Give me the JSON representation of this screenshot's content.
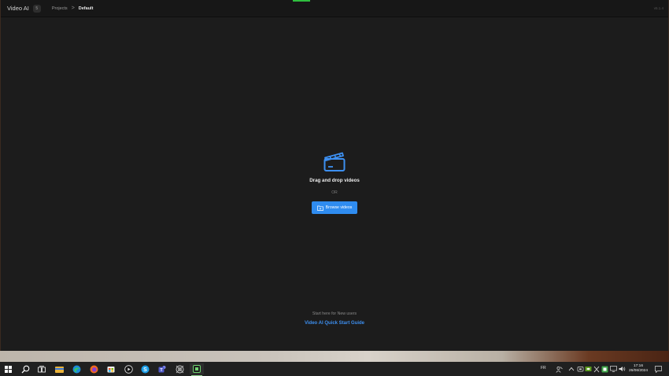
{
  "window": {
    "app_name": "Video AI",
    "app_badge": "5",
    "version": "v5.1.4"
  },
  "breadcrumb": {
    "projects": "Projects",
    "separator": ">",
    "current": "Default"
  },
  "dropzone": {
    "icon": "clapperboard-icon",
    "title": "Drag and drop videos",
    "or": "OR",
    "browse_label": "Browse videos"
  },
  "guide": {
    "hint": "Start here for New users",
    "link": "Video AI Quick Start Guide"
  },
  "taskbar": {
    "apps": [
      "windows-start-icon",
      "search-icon",
      "task-view-icon",
      "file-explorer-icon",
      "edge-icon",
      "firefox-icon",
      "store-icon",
      "video-player-icon",
      "skype-icon",
      "teams-icon",
      "settings-app-icon",
      "video-ai-icon"
    ],
    "language": "FR",
    "time": "17:16",
    "date": "26/06/2024"
  },
  "colors": {
    "accent": "#2f8cf0",
    "link": "#3d8ff0",
    "background": "#1c1c1c"
  }
}
